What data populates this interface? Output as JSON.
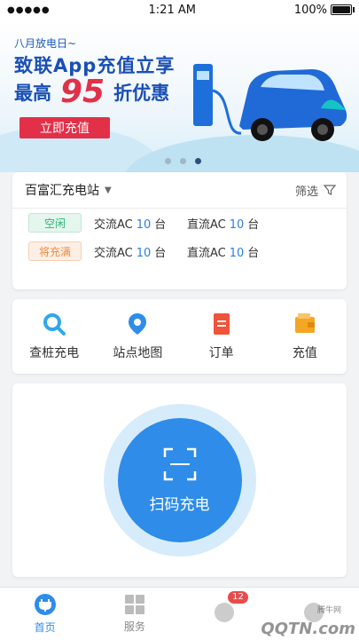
{
  "status": {
    "signal": "●●●●●",
    "time": "1:21 AM",
    "battery": "100%",
    "battery_level": 1.0
  },
  "banner": {
    "subtitle": "八月放电日~",
    "line1": "致联App充值立享",
    "line2_prefix": "最高",
    "line2_number": "95",
    "line2_suffix": "折优惠",
    "button": "立即充值",
    "pages": 3,
    "active_page": 3
  },
  "station": {
    "name": "百富汇充电站",
    "filter_label": "筛选",
    "rows": [
      {
        "tag": "空闲",
        "ac_label": "交流AC",
        "ac_count": "10",
        "ac_unit": "台",
        "dc_label": "直流AC",
        "dc_count": "10",
        "dc_unit": "台"
      },
      {
        "tag": "将充满",
        "ac_label": "交流AC",
        "ac_count": "10",
        "ac_unit": "台",
        "dc_label": "直流AC",
        "dc_count": "10",
        "dc_unit": "台"
      }
    ]
  },
  "menu": [
    {
      "label": "查桩充电",
      "icon": "search-icon"
    },
    {
      "label": "站点地图",
      "icon": "map-pin-icon"
    },
    {
      "label": "订单",
      "icon": "order-icon"
    },
    {
      "label": "充值",
      "icon": "wallet-icon"
    }
  ],
  "scan": {
    "label": "扫码充电"
  },
  "tabbar": [
    {
      "label": "首页",
      "icon": "home-plug-icon",
      "active": true
    },
    {
      "label": "服务",
      "icon": "grid-icon",
      "active": false
    },
    {
      "label": "",
      "icon": "message-icon",
      "badge": "12",
      "active": false
    },
    {
      "label": "",
      "icon": "profile-icon",
      "active": false
    }
  ],
  "watermark": {
    "text": "QQTN.com",
    "small": "腾牛网"
  },
  "colors": {
    "primary": "#2f8ce8",
    "banner_red": "#e23049",
    "idle": "#2bb673",
    "soon": "#f08a3c"
  }
}
